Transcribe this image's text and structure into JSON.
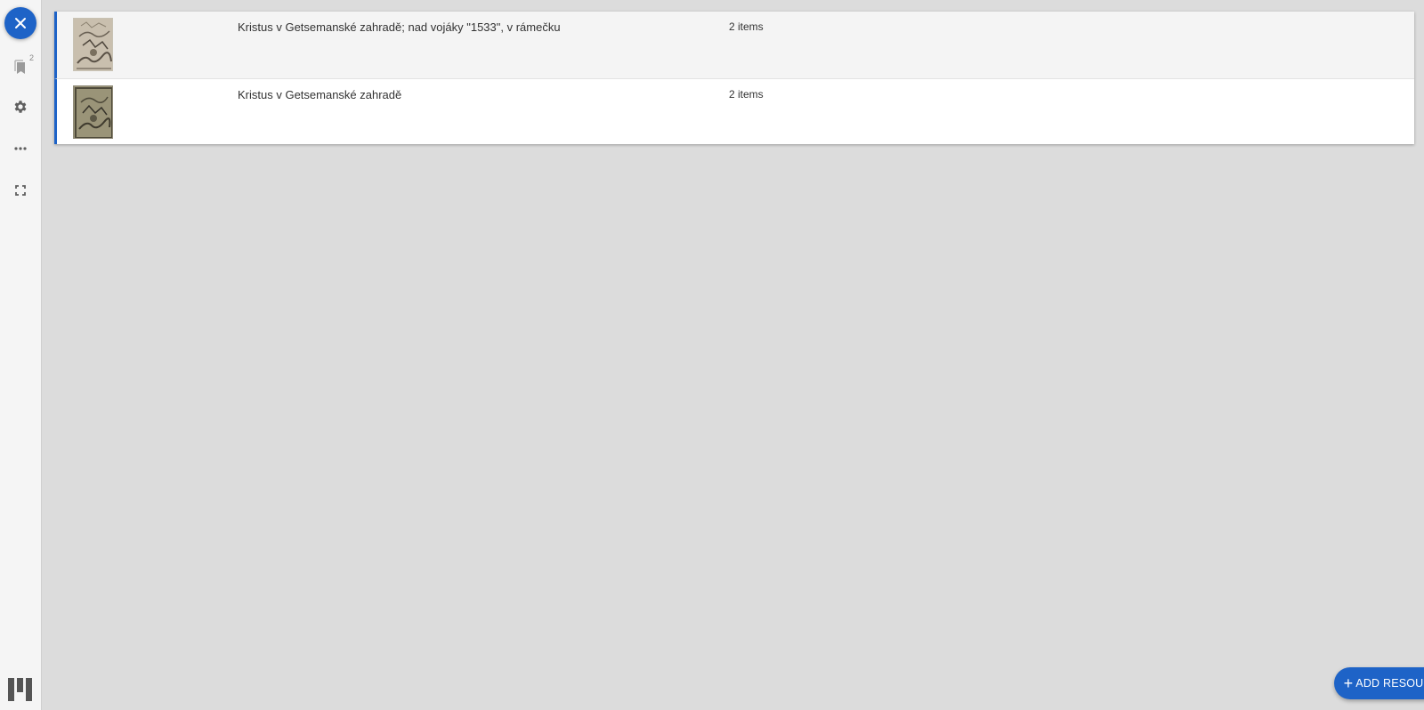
{
  "sidebar": {
    "bookmark_badge": "2",
    "buttons": [
      "close-icon",
      "bookmark-icon",
      "gear-icon",
      "more-horizontal-icon",
      "fullscreen-icon"
    ]
  },
  "resources": [
    {
      "title": "Kristus v Getsemanské zahradě; nad vojáky \"1533\", v rámečku",
      "count": "2 items",
      "thumbnail": "engraving-thumbnail"
    },
    {
      "title": "Kristus v Getsemanské zahradě",
      "count": "2 items",
      "thumbnail": "engraving-thumbnail"
    }
  ],
  "add_resource": {
    "label": "ADD RESOURCE"
  },
  "colors": {
    "accent": "#1e63c7",
    "background": "#dcdcdc",
    "rail": "#f5f5f5",
    "row_selected": "#f4f4f4"
  }
}
